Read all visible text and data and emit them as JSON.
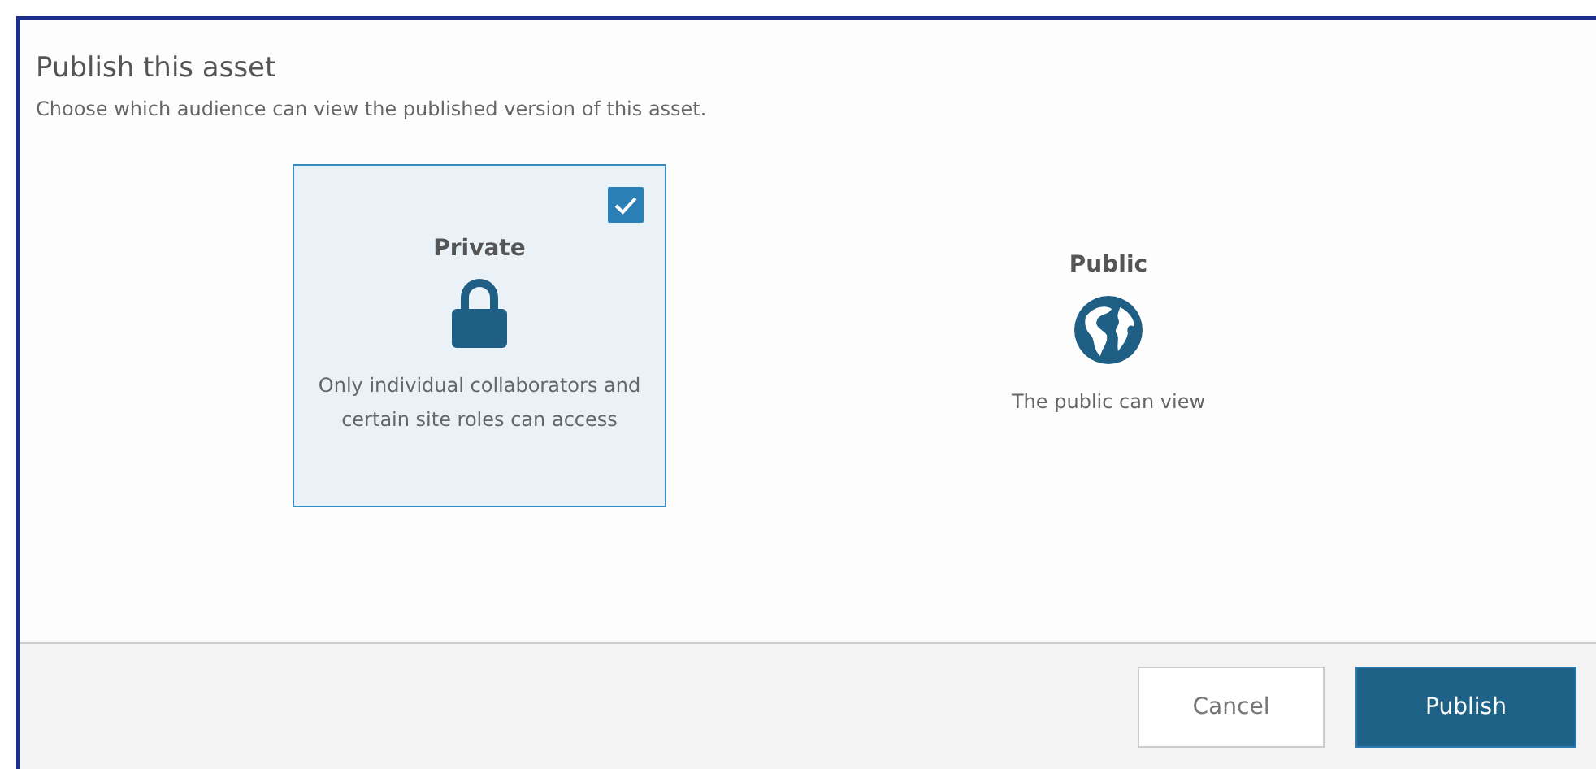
{
  "dialog": {
    "title": "Publish this asset",
    "description": "Choose which audience can view the published version of this asset."
  },
  "options": [
    {
      "kind": "lock",
      "title": "Private",
      "description": "Only individual collaborators and certain site roles can access",
      "selected": true
    },
    {
      "kind": "globe",
      "title": "Public",
      "description": "The public can view",
      "selected": false
    }
  ],
  "buttons": [
    {
      "kind": "secondary",
      "label": "Cancel"
    },
    {
      "kind": "primary",
      "label": "Publish"
    }
  ]
}
